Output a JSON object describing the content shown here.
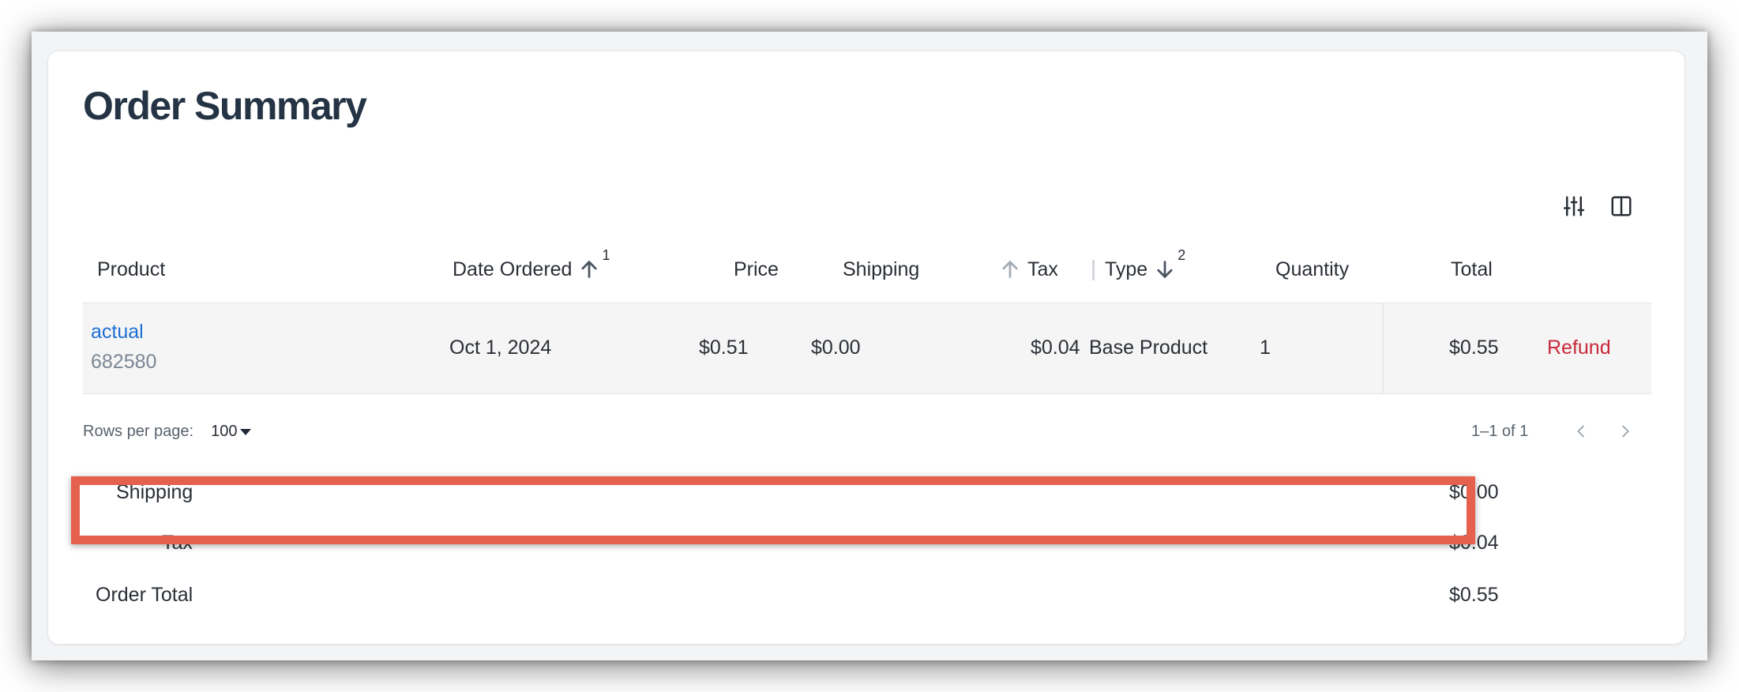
{
  "page": {
    "title": "Order Summary"
  },
  "toolbar": {
    "filter_icon": "sliders-icon",
    "columns_icon": "columns-icon"
  },
  "table": {
    "columns": {
      "product": "Product",
      "date_ordered": "Date Ordered",
      "date_sort_rank": "1",
      "price": "Price",
      "shipping": "Shipping",
      "tax": "Tax",
      "type": "Type",
      "type_sort_rank": "2",
      "quantity": "Quantity",
      "total": "Total"
    },
    "rows": [
      {
        "product_name": "actual",
        "product_sku": "682580",
        "date_ordered": "Oct 1, 2024",
        "price": "$0.51",
        "shipping": "$0.00",
        "tax": "$0.04",
        "type": "Base Product",
        "quantity": "1",
        "total": "$0.55",
        "action": "Refund"
      }
    ]
  },
  "pagination": {
    "rows_per_page_label": "Rows per page:",
    "rows_per_page_value": "100",
    "range": "1–1 of 1"
  },
  "summary": {
    "shipping_label": "Shipping",
    "shipping_value": "$0.00",
    "tax_label": "Tax",
    "tax_value": "$0.04",
    "total_label": "Order Total",
    "total_value": "$0.55"
  },
  "colors": {
    "link": "#1f6fd1",
    "refund": "#c8283a",
    "highlight": "#e5604d",
    "title": "#253445"
  }
}
